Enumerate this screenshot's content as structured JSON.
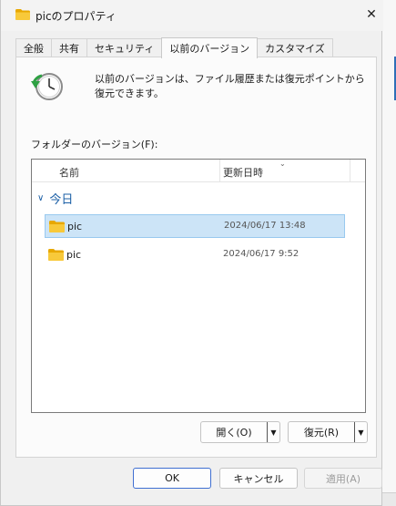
{
  "window": {
    "title": "picのプロパティ",
    "close_symbol": "✕"
  },
  "tabs": [
    {
      "label": "全般"
    },
    {
      "label": "共有"
    },
    {
      "label": "セキュリティ"
    },
    {
      "label": "以前のバージョン",
      "active": true
    },
    {
      "label": "カスタマイズ"
    }
  ],
  "panel": {
    "description": "以前のバージョンは、ファイル履歴または復元ポイントから復元できます。",
    "folder_versions_label": "フォルダーのバージョン(F):",
    "list": {
      "columns": {
        "name": "名前",
        "modified": "更新日時"
      },
      "sort_indicator": "⌄",
      "group_label": "今日",
      "group_chevron": "∨",
      "rows": [
        {
          "name": "pic",
          "modified": "2024/06/17 13:48",
          "selected": true
        },
        {
          "name": "pic",
          "modified": "2024/06/17 9:52",
          "selected": false
        }
      ]
    },
    "open_button": "開く(O)",
    "restore_button": "復元(R)",
    "dropdown_symbol": "▼"
  },
  "footer": {
    "ok": "OK",
    "cancel": "キャンセル",
    "apply": "適用(A)"
  },
  "colors": {
    "selected_row": "#cce4f7",
    "accent_border": "#3f6fd1",
    "group_text": "#1b5fa6",
    "folder_yellow": "#f8c93a"
  }
}
